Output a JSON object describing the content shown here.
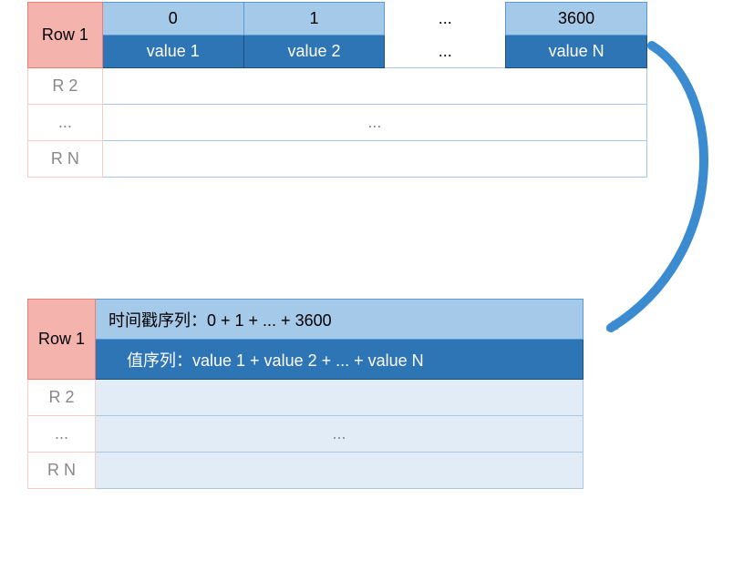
{
  "table1": {
    "row1_label": "Row 1",
    "r2_label": "R 2",
    "dots_label": "...",
    "rn_label": "R N",
    "cols_top": [
      "0",
      "1",
      "...",
      "3600"
    ],
    "cols_bottom": [
      "value 1",
      "value 2",
      "...",
      "value N"
    ],
    "body_dots": "..."
  },
  "table2": {
    "row1_label": "Row 1",
    "r2_label": "R 2",
    "dots_label": "...",
    "rn_label": "R N",
    "timestamp_seq": "时间戳序列：0 + 1 + ... + 3600",
    "value_seq": "值序列：value 1 + value 2 + ... + value N",
    "body_dots": "..."
  }
}
